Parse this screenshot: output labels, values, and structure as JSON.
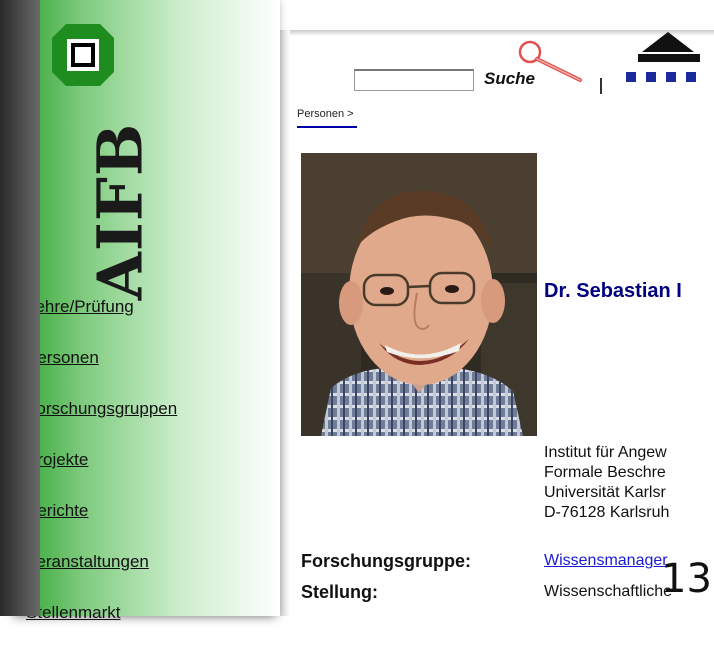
{
  "sidebar": {
    "logo_text": "AIFB",
    "items": [
      {
        "label": "Lehre/Prüfung"
      },
      {
        "label": "Personen"
      },
      {
        "label": "Forschungsgruppen"
      },
      {
        "label": "Projekte"
      },
      {
        "label": "Berichte"
      },
      {
        "label": "Veranstaltungen"
      },
      {
        "label": "Stellenmarkt"
      }
    ]
  },
  "search": {
    "label": "Suche",
    "value": ""
  },
  "breadcrumb": "Personen >",
  "person": {
    "name": "Dr. Sebastian I",
    "address": [
      "Institut für Angew",
      "Formale Beschre",
      "Universität Karlsr",
      "D-76128 Karlsruh"
    ],
    "fields": [
      {
        "label": "Forschungsgruppe:",
        "value": "Wissensmanager",
        "link": true
      },
      {
        "label": "Stellung:",
        "value": "Wissenschaftliche",
        "link": false
      }
    ]
  },
  "overlay_number": "13",
  "colors": {
    "sidebar_green": "#34a534",
    "logo_green": "#1e8c1e",
    "name_blue": "#000080",
    "link_blue": "#1a1ad6",
    "logo_navy": "#1a2a9a"
  }
}
